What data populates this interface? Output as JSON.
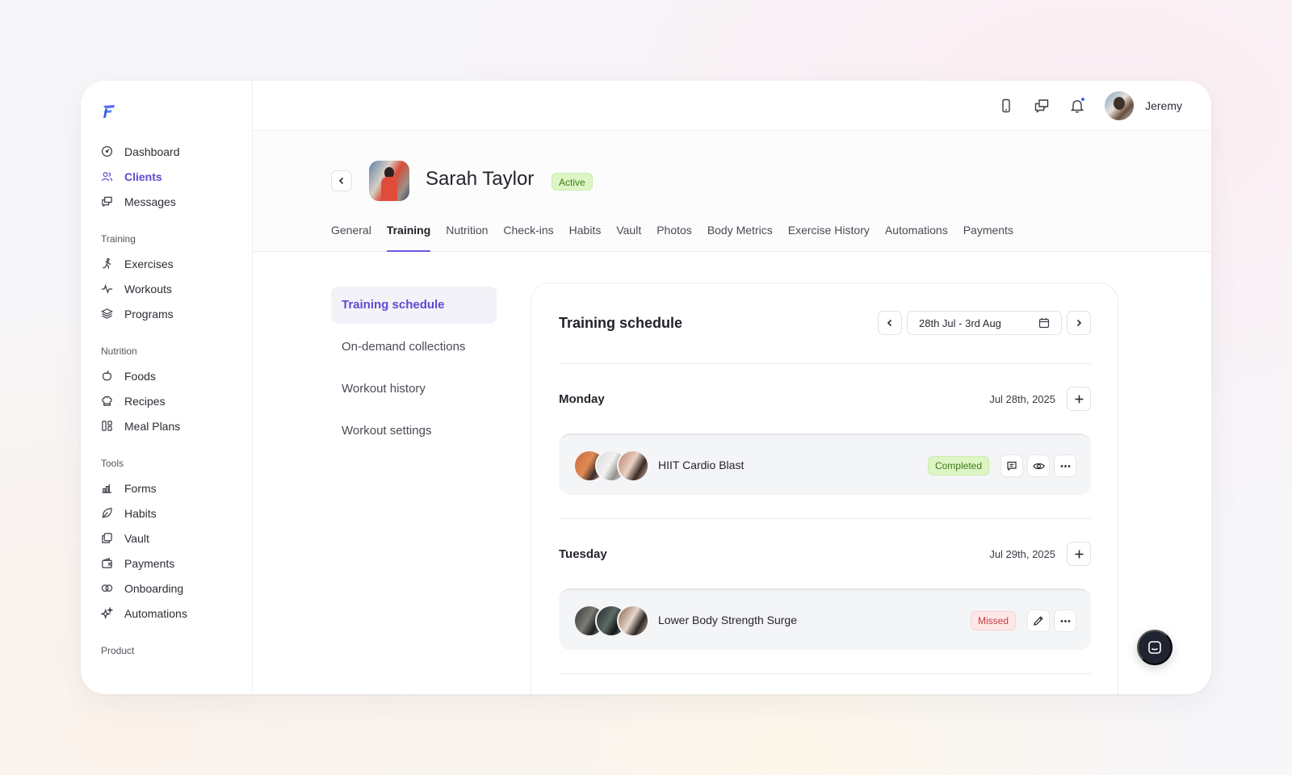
{
  "sidebar": {
    "main": [
      {
        "label": "Dashboard",
        "icon": "dashboard-icon"
      },
      {
        "label": "Clients",
        "icon": "users-icon",
        "active": true
      },
      {
        "label": "Messages",
        "icon": "messages-icon"
      }
    ],
    "sections": [
      {
        "title": "Training",
        "items": [
          {
            "label": "Exercises",
            "icon": "running-icon"
          },
          {
            "label": "Workouts",
            "icon": "pulse-icon"
          },
          {
            "label": "Programs",
            "icon": "layers-icon"
          }
        ]
      },
      {
        "title": "Nutrition",
        "items": [
          {
            "label": "Foods",
            "icon": "apple-icon"
          },
          {
            "label": "Recipes",
            "icon": "chef-hat-icon"
          },
          {
            "label": "Meal Plans",
            "icon": "grid-icon"
          }
        ]
      },
      {
        "title": "Tools",
        "items": [
          {
            "label": "Forms",
            "icon": "chart-icon"
          },
          {
            "label": "Habits",
            "icon": "leaf-icon"
          },
          {
            "label": "Vault",
            "icon": "folder-icon"
          },
          {
            "label": "Payments",
            "icon": "wallet-icon"
          },
          {
            "label": "Onboarding",
            "icon": "link-icon"
          },
          {
            "label": "Automations",
            "icon": "sparkle-icon"
          }
        ]
      },
      {
        "title": "Product",
        "items": []
      }
    ]
  },
  "topbar": {
    "user_name": "Jeremy"
  },
  "client": {
    "name": "Sarah Taylor",
    "status": "Active"
  },
  "tabs": [
    "General",
    "Training",
    "Nutrition",
    "Check-ins",
    "Habits",
    "Vault",
    "Photos",
    "Body Metrics",
    "Exercise History",
    "Automations",
    "Payments"
  ],
  "active_tab": "Training",
  "subnav": [
    "Training schedule",
    "On-demand collections",
    "Workout history",
    "Workout settings"
  ],
  "schedule": {
    "title": "Training schedule",
    "date_range": "28th Jul - 3rd Aug",
    "days": [
      {
        "day": "Monday",
        "date": "Jul 28th, 2025",
        "workout": "HIIT Cardio Blast",
        "status": "Completed"
      },
      {
        "day": "Tuesday",
        "date": "Jul 29th, 2025",
        "workout": "Lower Body Strength Surge",
        "status": "Missed"
      }
    ]
  },
  "colors": {
    "accent": "#5b4ccf",
    "completed": "#3f7a16",
    "missed": "#c53a3a"
  }
}
